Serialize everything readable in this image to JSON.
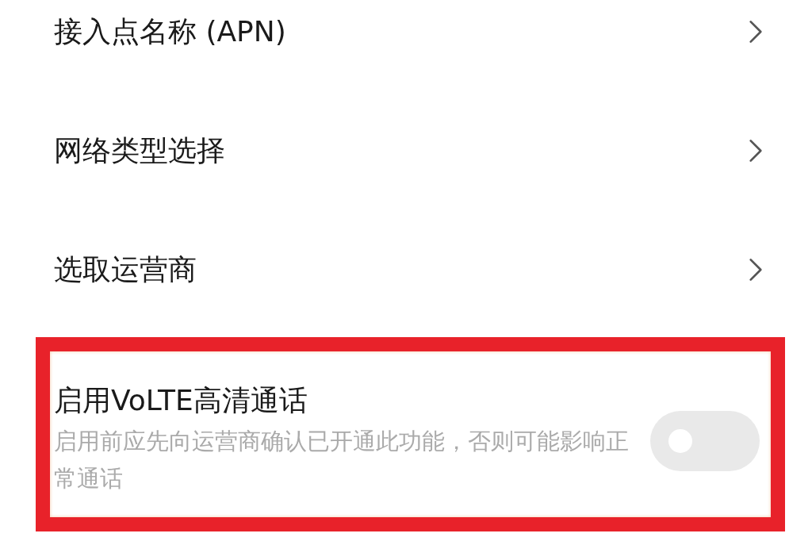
{
  "settings": [
    {
      "kind": "link",
      "title": "接入点名称 (APN)"
    },
    {
      "kind": "link",
      "title": "网络类型选择"
    },
    {
      "kind": "link",
      "title": "选取运营商"
    },
    {
      "kind": "toggle",
      "title": "启用VoLTE高清通话",
      "summary": "启用前应先向运营商确认已开通此功能，否则可能影响正常通话",
      "on": false,
      "highlighted": true
    }
  ]
}
